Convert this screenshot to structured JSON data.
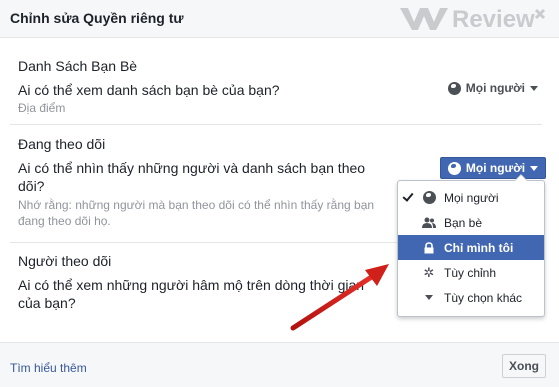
{
  "dialog": {
    "title": "Chỉnh sửa Quyền riêng tư",
    "watermark": "Review"
  },
  "sections": {
    "friends": {
      "title": "Danh Sách Bạn Bè",
      "question": "Ai có thể xem danh sách bạn bè của bạn?",
      "note": "Địa điểm",
      "audience": "Mọi người"
    },
    "following": {
      "title": "Đang theo dõi",
      "question": "Ai có thể nhìn thấy những người và danh sách bạn theo dõi?",
      "note": "Nhớ rằng: những người mà bạn theo dõi có thể nhìn thấy rằng bạn đang theo dõi họ.",
      "audience": "Mọi người"
    },
    "followers": {
      "title": "Người theo dõi",
      "question": "Ai có thể xem những người hâm mộ trên dòng thời gian của bạn?"
    }
  },
  "menu": {
    "items": [
      {
        "label": "Mọi người",
        "icon": "globe-icon",
        "checked": true
      },
      {
        "label": "Bạn bè",
        "icon": "friends-icon"
      },
      {
        "label": "Chỉ mình tôi",
        "icon": "lock-icon",
        "highlighted": true
      },
      {
        "label": "Tùy chỉnh",
        "icon": "gear-icon"
      },
      {
        "label": "Tùy chọn khác",
        "icon": "caret-down-icon"
      }
    ]
  },
  "footer": {
    "learn_more": "Tìm hiểu thêm",
    "close": "Xong"
  },
  "colors": {
    "accent": "#4267b2",
    "link": "#365899",
    "annotation_arrow": "#d0201a"
  }
}
